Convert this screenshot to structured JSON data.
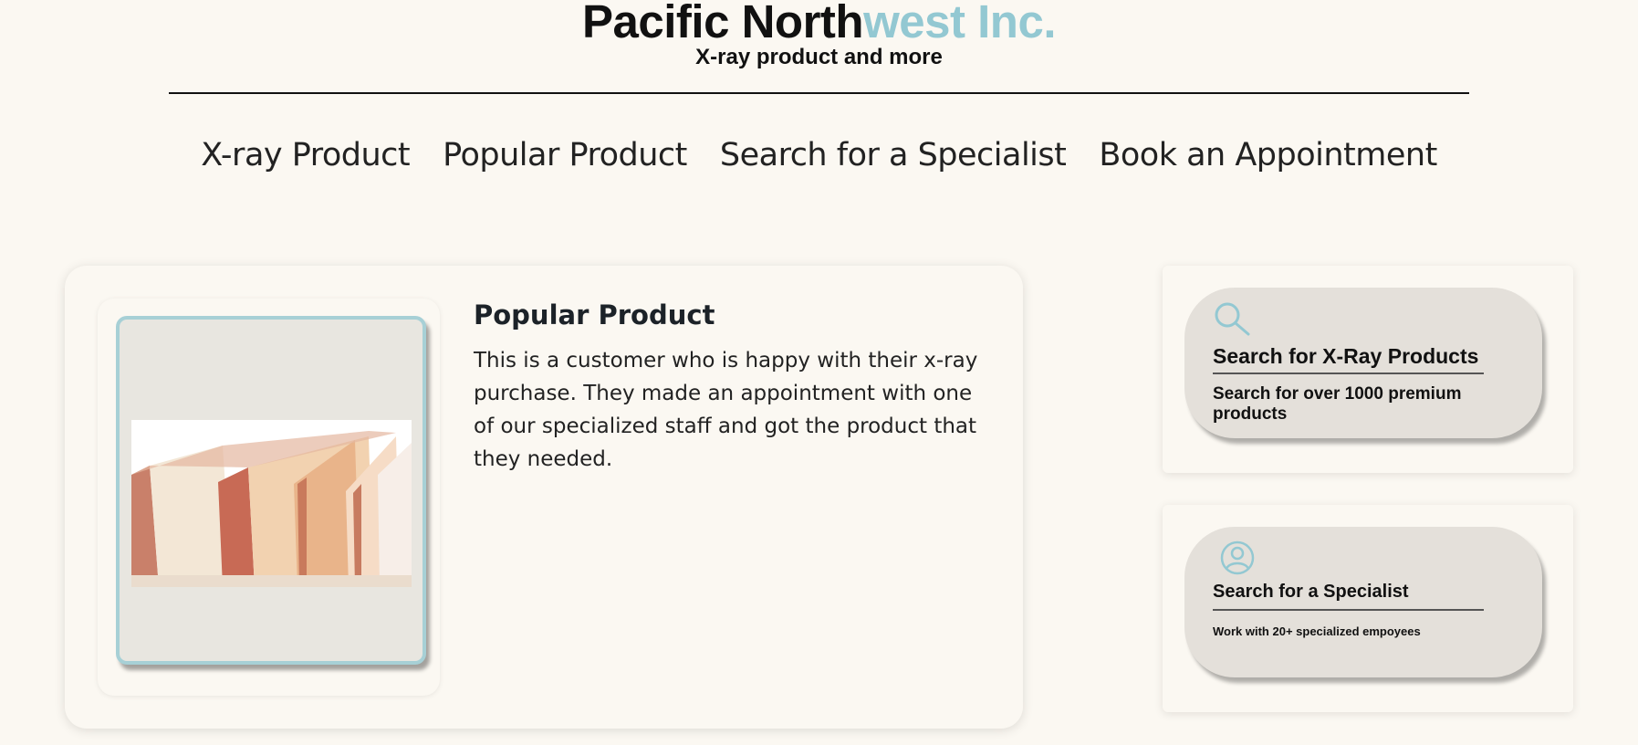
{
  "header": {
    "brand_dark": "Pacific North",
    "brand_light": "west Inc.",
    "tagline": "X-ray product and more"
  },
  "nav": {
    "items": [
      {
        "label": "X-ray Product"
      },
      {
        "label": "Popular Product"
      },
      {
        "label": "Search for a Specialist"
      },
      {
        "label": "Book an Appointment"
      }
    ]
  },
  "feature": {
    "title": "Popular Product",
    "body": "This is a customer who is happy with their x-ray purchase. They made an appointment with one of our specialized staff and got the product that they needed."
  },
  "side_cards": [
    {
      "icon": "search-icon",
      "title": "Search for X-Ray Products",
      "subtitle": "Search for over 1000 premium products"
    },
    {
      "icon": "user-icon",
      "title": "Search for a Specialist",
      "subtitle": "Work with 20+ specialized empoyees"
    }
  ],
  "colors": {
    "background": "#fbf8f2",
    "accent": "#93c8d2",
    "pill": "#e4e0da"
  }
}
